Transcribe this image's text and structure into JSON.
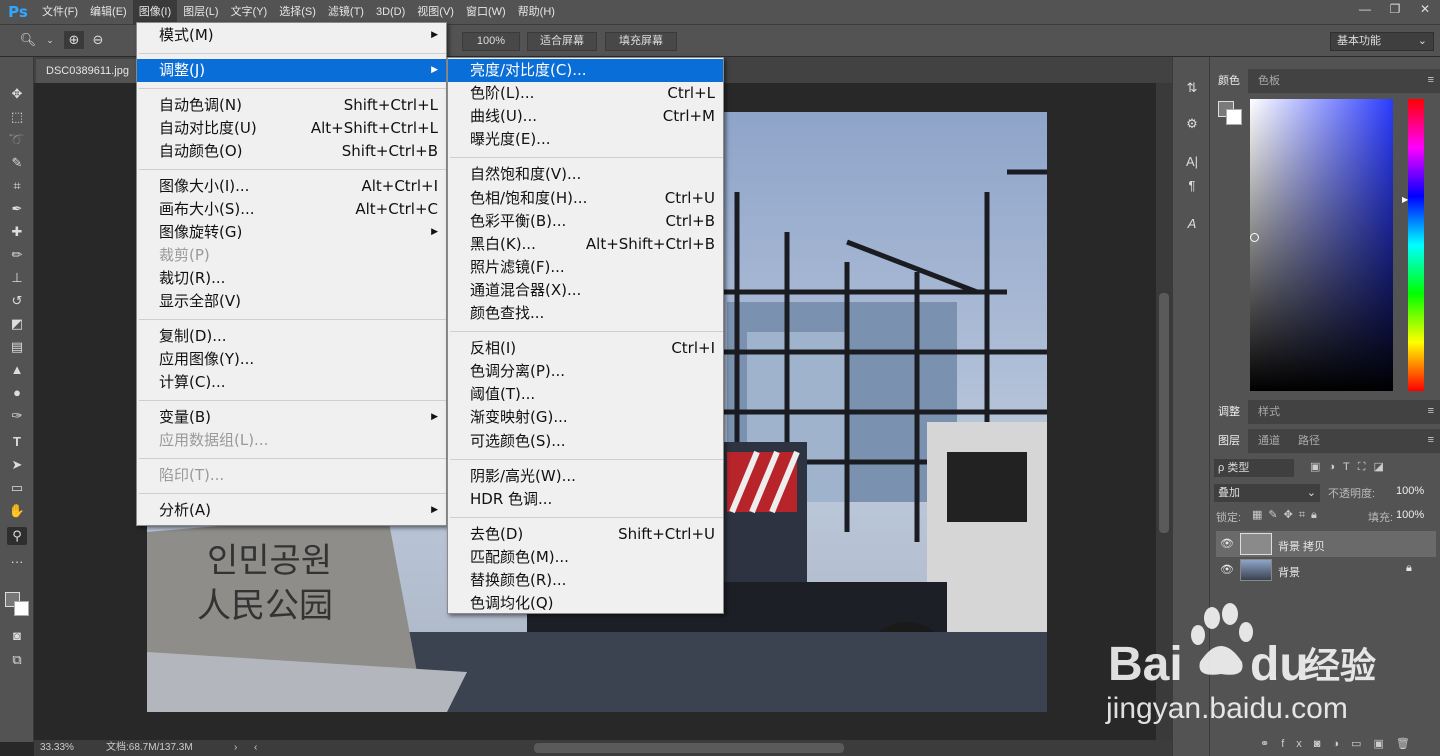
{
  "menubar": {
    "logo": "Ps",
    "items": [
      "文件(F)",
      "编辑(E)",
      "图像(I)",
      "图层(L)",
      "文字(Y)",
      "选择(S)",
      "滤镜(T)",
      "3D(D)",
      "视图(V)",
      "窗口(W)",
      "帮助(H)"
    ],
    "active_index": 2,
    "window_controls": [
      "—",
      "❐",
      "✕"
    ]
  },
  "options": {
    "zoom_100": "100%",
    "fit_screen": "适合屏幕",
    "fill_screen": "填充屏幕",
    "workspace": "基本功能"
  },
  "document": {
    "tab": "DSC0389611.jpg",
    "zoom": "33.33%",
    "doc_info": "文档:68.7M/137.3M"
  },
  "image_menu": [
    {
      "label": "模式(M)",
      "sub": true
    },
    {
      "sep": true
    },
    {
      "label": "调整(J)",
      "sub": true,
      "highlight": true
    },
    {
      "sep": true
    },
    {
      "label": "自动色调(N)",
      "shortcut": "Shift+Ctrl+L"
    },
    {
      "label": "自动对比度(U)",
      "shortcut": "Alt+Shift+Ctrl+L"
    },
    {
      "label": "自动颜色(O)",
      "shortcut": "Shift+Ctrl+B"
    },
    {
      "sep": true
    },
    {
      "label": "图像大小(I)...",
      "shortcut": "Alt+Ctrl+I"
    },
    {
      "label": "画布大小(S)...",
      "shortcut": "Alt+Ctrl+C"
    },
    {
      "label": "图像旋转(G)",
      "sub": true
    },
    {
      "label": "裁剪(P)",
      "disabled": true
    },
    {
      "label": "裁切(R)..."
    },
    {
      "label": "显示全部(V)"
    },
    {
      "sep": true
    },
    {
      "label": "复制(D)..."
    },
    {
      "label": "应用图像(Y)..."
    },
    {
      "label": "计算(C)..."
    },
    {
      "sep": true
    },
    {
      "label": "变量(B)",
      "sub": true
    },
    {
      "label": "应用数据组(L)...",
      "disabled": true
    },
    {
      "sep": true
    },
    {
      "label": "陷印(T)...",
      "disabled": true
    },
    {
      "sep": true
    },
    {
      "label": "分析(A)",
      "sub": true
    }
  ],
  "adjust_menu": [
    {
      "label": "亮度/对比度(C)...",
      "highlight": true
    },
    {
      "label": "色阶(L)...",
      "shortcut": "Ctrl+L"
    },
    {
      "label": "曲线(U)...",
      "shortcut": "Ctrl+M"
    },
    {
      "label": "曝光度(E)..."
    },
    {
      "sep": true
    },
    {
      "label": "自然饱和度(V)..."
    },
    {
      "label": "色相/饱和度(H)...",
      "shortcut": "Ctrl+U"
    },
    {
      "label": "色彩平衡(B)...",
      "shortcut": "Ctrl+B"
    },
    {
      "label": "黑白(K)...",
      "shortcut": "Alt+Shift+Ctrl+B"
    },
    {
      "label": "照片滤镜(F)..."
    },
    {
      "label": "通道混合器(X)..."
    },
    {
      "label": "颜色查找..."
    },
    {
      "sep": true
    },
    {
      "label": "反相(I)",
      "shortcut": "Ctrl+I"
    },
    {
      "label": "色调分离(P)..."
    },
    {
      "label": "阈值(T)..."
    },
    {
      "label": "渐变映射(G)..."
    },
    {
      "label": "可选颜色(S)..."
    },
    {
      "sep": true
    },
    {
      "label": "阴影/高光(W)..."
    },
    {
      "label": "HDR 色调..."
    },
    {
      "sep": true
    },
    {
      "label": "去色(D)",
      "shortcut": "Shift+Ctrl+U"
    },
    {
      "label": "匹配颜色(M)..."
    },
    {
      "label": "替换颜色(R)..."
    },
    {
      "label": "色调均化(Q)"
    }
  ],
  "panels": {
    "color_tabs": [
      "颜色",
      "色板"
    ],
    "adjust_tabs": [
      "调整",
      "样式"
    ],
    "layer_tabs": [
      "图层",
      "通道",
      "路径"
    ],
    "filter_kind": "ρ 类型",
    "blend_mode": "叠加",
    "opacity_label": "不透明度:",
    "opacity_value": "100%",
    "lock_label": "锁定:",
    "fill_label": "填充:",
    "fill_value": "100%",
    "layers": [
      {
        "name": "背景 拷贝",
        "selected": true,
        "locked": false
      },
      {
        "name": "背景",
        "selected": false,
        "locked": true
      }
    ]
  },
  "stone_text": [
    "인민공원",
    "人民公园"
  ],
  "watermark": {
    "brand_a": "Bai",
    "brand_b": "du",
    "brand_c": "经验",
    "url": "jingyan.baidu.com"
  },
  "colors": {
    "accent_blue": "#0a6ed8",
    "panel": "#535353",
    "dark": "#282828"
  }
}
